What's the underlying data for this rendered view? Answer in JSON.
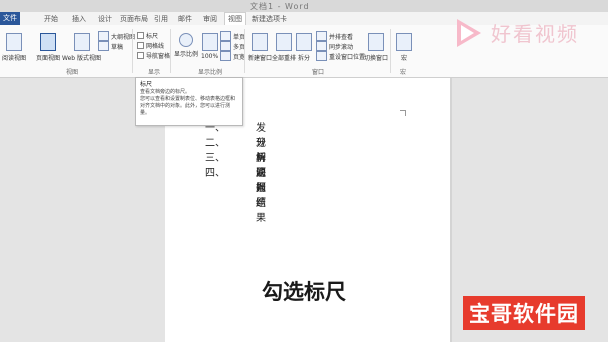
{
  "titlebar": {
    "title": "文档1 - Word"
  },
  "tabs": {
    "file": "文件",
    "items": [
      "开始",
      "插入",
      "设计",
      "页面布局",
      "引用",
      "邮件",
      "审阅",
      "视图",
      "新建选项卡"
    ]
  },
  "ribbon": {
    "views": {
      "read_mode": "阅读视图",
      "print_layout": "页面视图",
      "web_layout": "Web 版式视图",
      "outline": "大纲视图",
      "draft": "草稿",
      "group_label": "视图"
    },
    "show": {
      "ruler": "标尺",
      "gridlines": "网格线",
      "navigation": "导航窗格",
      "group_label": "显示"
    },
    "zoom": {
      "zoom": "显示比例",
      "hundred": "100%",
      "one_page": "单页",
      "multi_page": "多页",
      "page_width": "页宽",
      "group_label": "显示比例"
    },
    "window": {
      "new_window": "新建窗口",
      "arrange_all": "全部重排",
      "split": "拆分",
      "side_by_side": "并排查看",
      "sync_scroll": "同步滚动",
      "reset_position": "重设窗口位置",
      "switch_windows": "切换窗口",
      "group_label": "窗口"
    },
    "macros": {
      "label": "宏",
      "group_label": "宏"
    }
  },
  "tooltip": {
    "title": "标尺",
    "line1": "查看文档旁边的标尺。",
    "line2": "您可以查看和设置制表位、移动表格边框和对齐文档中的对象。此外，您可以进行测量。"
  },
  "document": {
    "items": [
      {
        "num": "一、",
        "text": "发现问题"
      },
      {
        "num": "二、",
        "text": "分析问题"
      },
      {
        "num": "三、",
        "text": "解决问题"
      },
      {
        "num": "四、",
        "text": "汇报结果"
      }
    ]
  },
  "caption": "勾选标尺",
  "brand": {
    "text": "好看视频"
  },
  "watermark": "宝哥软件园"
}
